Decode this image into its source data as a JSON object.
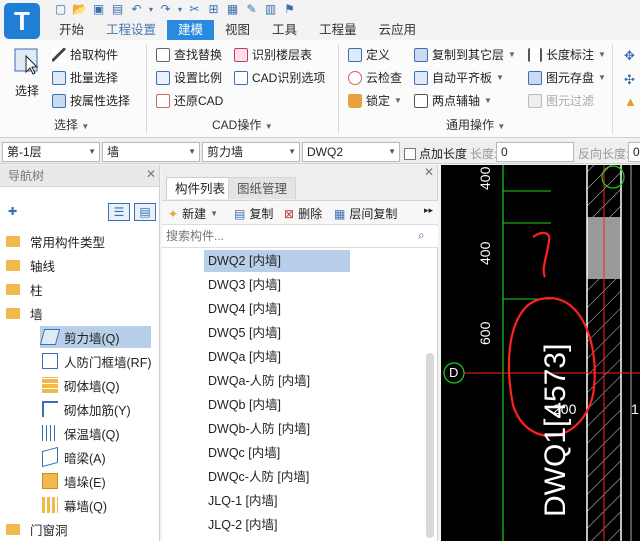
{
  "app": {
    "logo_letter": "T"
  },
  "quick_access": [
    "new-icon",
    "open-icon",
    "save-icon",
    "undo-icon",
    "redo-icon",
    "dropdown-icon",
    "cut-icon",
    "query-icon",
    "copy-icon",
    "edit-icon",
    "grid-icon",
    "flag-icon"
  ],
  "tabs": [
    {
      "label": "开始",
      "state": "normal"
    },
    {
      "label": "工程设置",
      "state": "dim"
    },
    {
      "label": "建模",
      "state": "active"
    },
    {
      "label": "视图",
      "state": "normal"
    },
    {
      "label": "工具",
      "state": "normal"
    },
    {
      "label": "工程量",
      "state": "normal"
    },
    {
      "label": "云应用",
      "state": "normal"
    }
  ],
  "ribbon": {
    "select": {
      "big_label": "选择",
      "pick": "拾取构件",
      "batch": "批量选择",
      "by_attr": "按属性选择",
      "group": "选择"
    },
    "cad": {
      "find_replace": "查找替换",
      "recognize_floor": "识别楼层表",
      "set_scale": "设置比例",
      "cad_options": "CAD识别选项",
      "restore": "还原CAD",
      "group": "CAD操作"
    },
    "common": {
      "define": "定义",
      "copy_to_floor": "复制到其它层",
      "length_label": "长度标注",
      "cloud_check": "云检查",
      "auto_level": "自动平齐板",
      "save_element": "图元存盘",
      "lock": "锁定",
      "two_point": "两点辅轴",
      "filter": "图元过滤",
      "group": "通用操作"
    }
  },
  "combos": {
    "floor": "第-1层",
    "category": "墙",
    "type": "剪力墙",
    "component": "DWQ2",
    "point_length_label": "点加长度",
    "length_label": "长度:",
    "length_value": "0",
    "reverse_label": "反向长度:",
    "reverse_value": "0"
  },
  "nav": {
    "title": "导航树",
    "items": [
      {
        "label": "常用构件类型",
        "level": 0
      },
      {
        "label": "轴线",
        "level": 0
      },
      {
        "label": "柱",
        "level": 0
      },
      {
        "label": "墙",
        "level": 0
      },
      {
        "label": "剪力墙(Q)",
        "level": 1,
        "selected": true
      },
      {
        "label": "人防门框墙(RF)",
        "level": 1
      },
      {
        "label": "砌体墙(Q)",
        "level": 1
      },
      {
        "label": "砌体加筋(Y)",
        "level": 1
      },
      {
        "label": "保温墙(Q)",
        "level": 1
      },
      {
        "label": "暗梁(A)",
        "level": 1
      },
      {
        "label": "墙垛(E)",
        "level": 1
      },
      {
        "label": "幕墙(Q)",
        "level": 1
      },
      {
        "label": "门窗洞",
        "level": 0
      }
    ]
  },
  "comp": {
    "tab_list": "构件列表",
    "tab_drawing": "图纸管理",
    "new": "新建",
    "copy": "复制",
    "delete": "删除",
    "floor_copy": "层间复制",
    "search_placeholder": "搜索构件...",
    "items": [
      {
        "label": "DWQ2 [内墙]",
        "selected": true
      },
      {
        "label": "DWQ3 [内墙]"
      },
      {
        "label": "DWQ4 [内墙]"
      },
      {
        "label": "DWQ5 [内墙]"
      },
      {
        "label": "DWQa [内墙]"
      },
      {
        "label": "DWQa-人防 [内墙]"
      },
      {
        "label": "DWQb [内墙]"
      },
      {
        "label": "DWQb-人防 [内墙]"
      },
      {
        "label": "DWQc [内墙]"
      },
      {
        "label": "DWQc-人防 [内墙]"
      },
      {
        "label": "JLQ-1 [内墙]"
      },
      {
        "label": "JLQ-2 [内墙]"
      }
    ]
  },
  "cad": {
    "dim_400a": "400",
    "dim_400b": "400",
    "dim_600": "600",
    "axis_d": "D",
    "label_dwq": "DWQ1[4573]",
    "dim_200": "200",
    "edge_1": "1"
  },
  "colors": {
    "accent": "#2b8ae0",
    "selected_row": "#b8cfea",
    "cad_bg": "#000000",
    "cad_green": "#19d219",
    "cad_red": "#ff2020"
  }
}
